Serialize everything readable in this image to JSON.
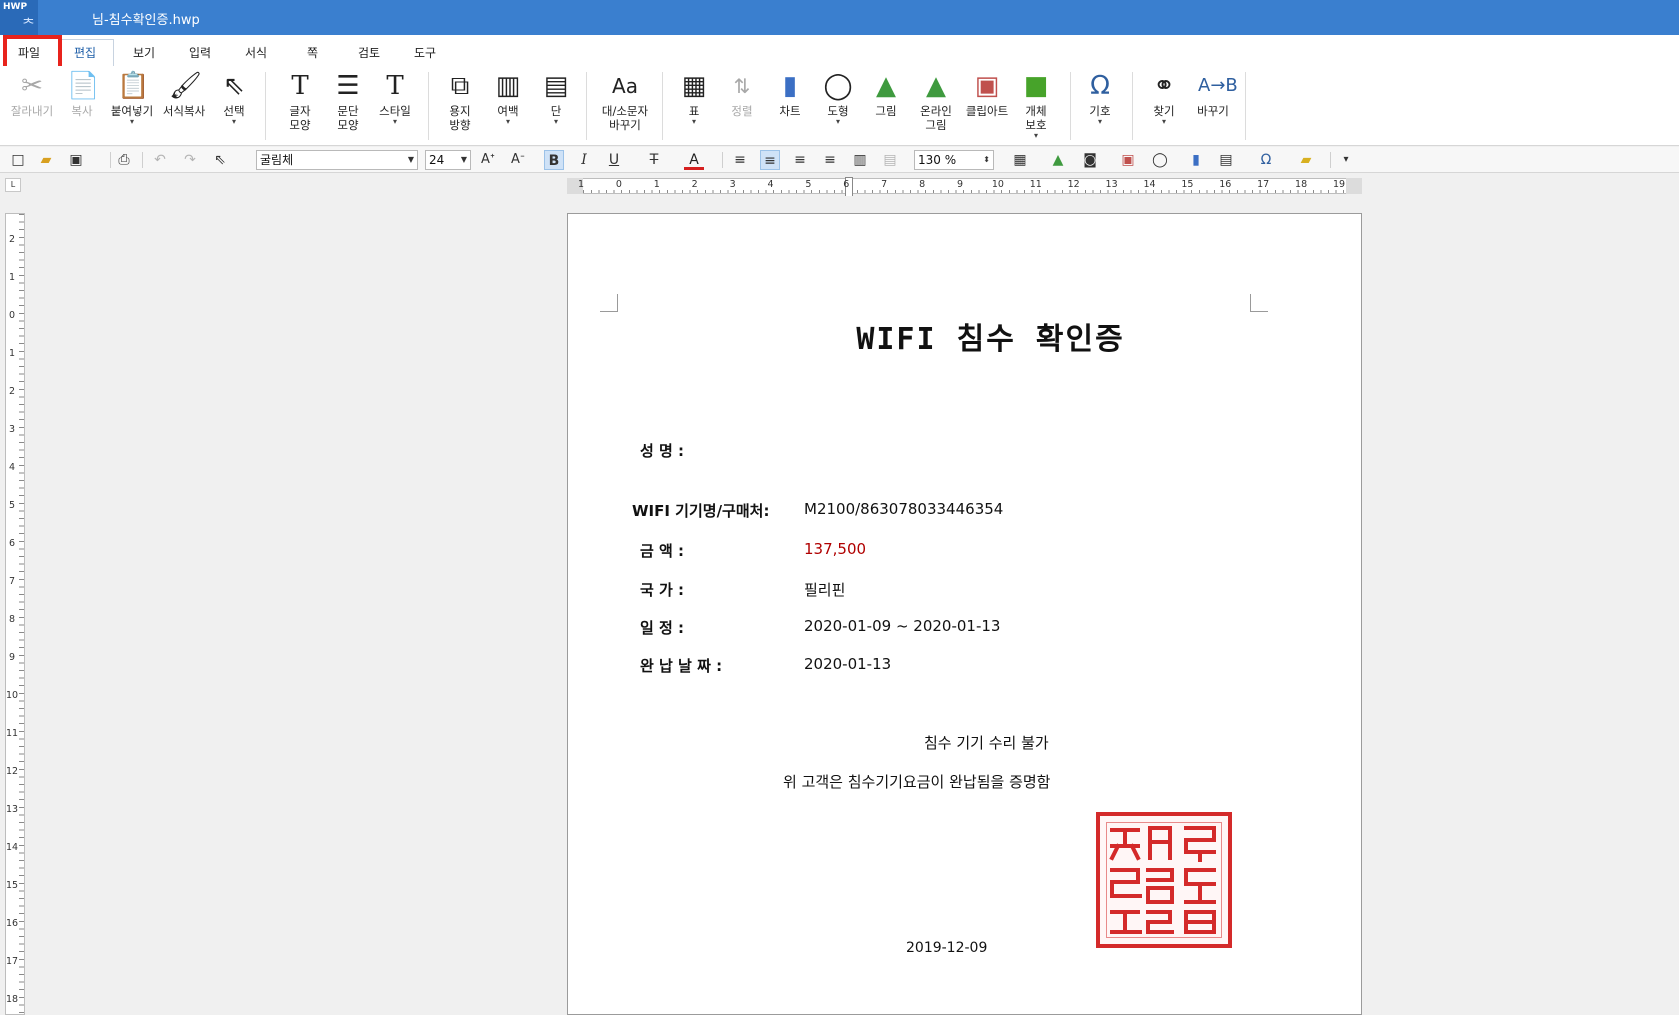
{
  "window": {
    "app_badge": "HWP",
    "title": "님-침수확인증.hwp"
  },
  "menu": {
    "tabs": [
      "파일",
      "편집",
      "보기",
      "입력",
      "서식",
      "쪽",
      "검토",
      "도구"
    ],
    "active_tab": "편집",
    "highlighted_tab": "파일"
  },
  "ribbon": {
    "items": [
      {
        "label": "잘라내기",
        "icon": "scissors-icon",
        "enabled": false
      },
      {
        "label": "복사",
        "icon": "copy-icon",
        "enabled": false
      },
      {
        "label": "붙여넣기",
        "icon": "paste-icon",
        "enabled": true
      },
      {
        "label": "서식복사",
        "icon": "format-painter-icon",
        "enabled": true
      },
      {
        "label": "선택",
        "icon": "cursor-icon",
        "enabled": true
      },
      {
        "label": "글자\n모양",
        "icon": "char-shape-icon",
        "enabled": true
      },
      {
        "label": "문단\n모양",
        "icon": "paragraph-shape-icon",
        "enabled": true
      },
      {
        "label": "스타일",
        "icon": "style-icon",
        "enabled": true
      },
      {
        "label": "용지\n방향",
        "icon": "page-orientation-icon",
        "enabled": true
      },
      {
        "label": "여백",
        "icon": "margin-icon",
        "enabled": true
      },
      {
        "label": "단",
        "icon": "columns-icon",
        "enabled": true
      },
      {
        "label": "대/소문자\n바꾸기",
        "icon": "change-case-icon",
        "enabled": true
      },
      {
        "label": "표",
        "icon": "table-icon",
        "enabled": true
      },
      {
        "label": "정렬",
        "icon": "sort-icon",
        "enabled": false
      },
      {
        "label": "차트",
        "icon": "chart-icon",
        "enabled": true
      },
      {
        "label": "도형",
        "icon": "shape-icon",
        "enabled": true
      },
      {
        "label": "그림",
        "icon": "picture-icon",
        "enabled": true
      },
      {
        "label": "온라인\n그림",
        "icon": "online-picture-icon",
        "enabled": true
      },
      {
        "label": "클립아트",
        "icon": "clipart-icon",
        "enabled": true
      },
      {
        "label": "개체\n보호",
        "icon": "object-protect-icon",
        "enabled": true
      },
      {
        "label": "기호",
        "icon": "omega-icon",
        "enabled": true
      },
      {
        "label": "찾기",
        "icon": "binoculars-icon",
        "enabled": true
      },
      {
        "label": "바꾸기",
        "icon": "replace-icon",
        "enabled": true
      }
    ]
  },
  "format_toolbar": {
    "font_name": "굴림체",
    "font_size": "24",
    "zoom": "130 %"
  },
  "ruler": {
    "h_numbers": [
      "1",
      "0",
      "1",
      "2",
      "3",
      "4",
      "5",
      "6",
      "7",
      "8",
      "9",
      "10",
      "11",
      "12",
      "13",
      "14",
      "15",
      "16",
      "17",
      "18",
      "19"
    ],
    "v_numbers": [
      "2",
      "1",
      "0",
      "1",
      "2",
      "3",
      "4",
      "5",
      "6",
      "7",
      "8",
      "9",
      "10",
      "11",
      "12",
      "13",
      "14",
      "15",
      "16",
      "17",
      "18"
    ],
    "corner_mark": "L"
  },
  "document": {
    "title": "WIFI 침수 확인증",
    "fields": [
      {
        "label": "성         명 :",
        "value": ""
      },
      {
        "label": "WIFI 기기명/구매처:",
        "value": "M2100/863078033446354"
      },
      {
        "label": "금         액 :",
        "value": "137,500"
      },
      {
        "label": "국         가 :",
        "value": "필리핀"
      },
      {
        "label": "일         정 :",
        "value": "2020-01-09 ~ 2020-01-13"
      },
      {
        "label": "완  납 날 짜 :",
        "value": "2020-01-13"
      }
    ],
    "notice_line1": "침수 기기 수리 불가",
    "notice_line2": "위 고객은  침수기기요금이 완납됨을 증명함",
    "date": "2019-12-09",
    "amount_color": "#b00000",
    "stamp_color": "#d42a2a"
  }
}
